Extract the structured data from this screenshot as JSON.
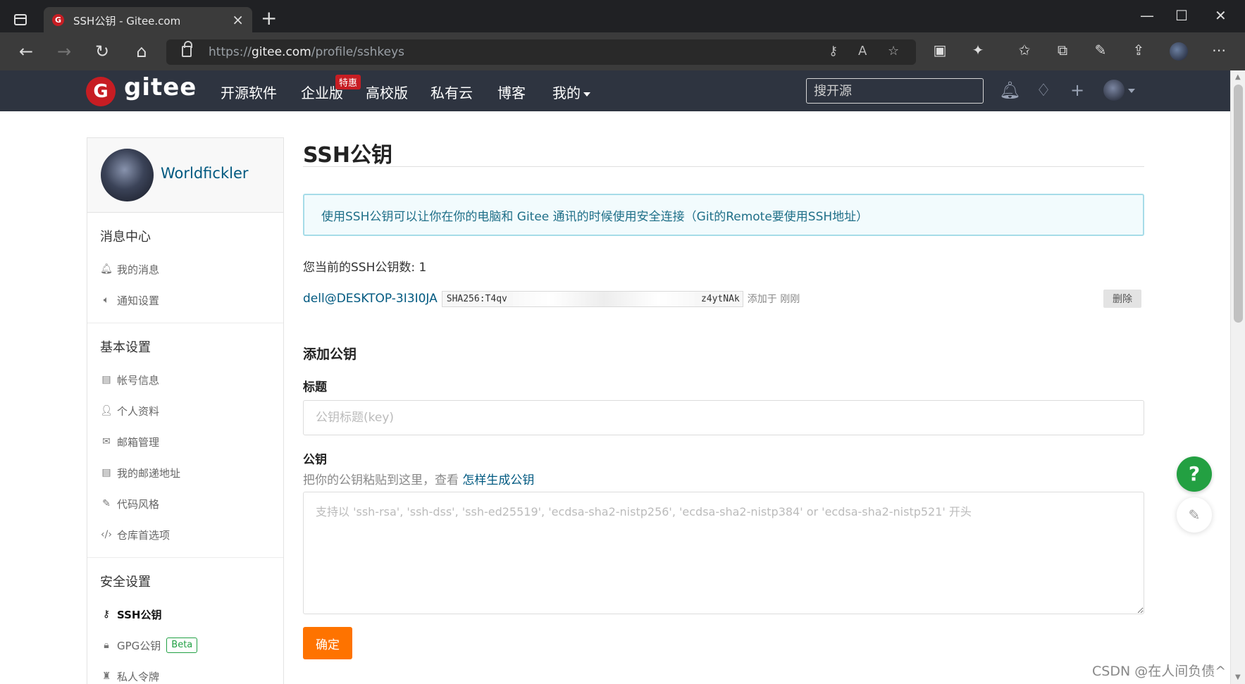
{
  "browser": {
    "tab_title": "SSH公钥 - Gitee.com",
    "favicon_letter": "G",
    "url_scheme": "https://",
    "url_host": "gitee.com",
    "url_path": "/profile/sshkeys"
  },
  "nav": {
    "logo_letter": "G",
    "logo_text": "gitee",
    "links": [
      "开源软件",
      "企业版",
      "高校版",
      "私有云",
      "博客",
      "我的"
    ],
    "promo_badge": "特惠",
    "search_placeholder": "搜开源"
  },
  "sidebar": {
    "username": "Worldfickler",
    "sections": [
      {
        "title": "消息中心",
        "items": [
          "我的消息",
          "通知设置"
        ]
      },
      {
        "title": "基本设置",
        "items": [
          "帐号信息",
          "个人资料",
          "邮箱管理",
          "我的邮递地址",
          "代码风格",
          "仓库首选项"
        ]
      },
      {
        "title": "安全设置",
        "items": [
          "SSH公钥",
          "GPG公钥",
          "私人令牌"
        ]
      }
    ],
    "beta_badge": "Beta"
  },
  "main": {
    "title": "SSH公钥",
    "info": "使用SSH公钥可以让你在你的电脑和 Gitee 通讯的时候使用安全连接（Git的Remote要使用SSH地址）",
    "key_count_label": "您当前的SSH公钥数: 1",
    "key": {
      "user": "dell@DESKTOP-3I3I0JA",
      "fingerprint_head": "SHA256:T4qv",
      "fingerprint_tail": "z4ytNAk",
      "added": "添加于 刚刚",
      "delete_label": "删除"
    },
    "add_title": "添加公钥",
    "title_label": "标题",
    "title_placeholder": "公钥标题(key)",
    "key_label": "公钥",
    "help_text": "把你的公钥粘贴到这里，查看",
    "help_link": "怎样生成公钥",
    "key_placeholder": "支持以 'ssh-rsa', 'ssh-dss', 'ssh-ed25519', 'ecdsa-sha2-nistp256', 'ecdsa-sha2-nistp384' or 'ecdsa-sha2-nistp521' 开头",
    "submit_label": "确定"
  },
  "fab": {
    "help": "?"
  },
  "watermark": "CSDN @在人间负债^"
}
